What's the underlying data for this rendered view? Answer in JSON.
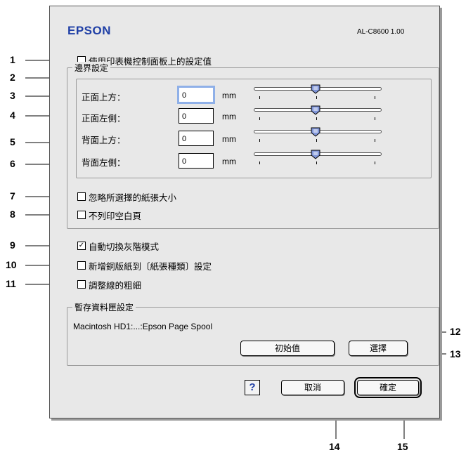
{
  "header": {
    "brand": "EPSON",
    "model": "AL-C8600 1.00"
  },
  "options": {
    "use_panel_settings": {
      "label": "使用印表機控制面板上的設定值",
      "checked": false
    },
    "ignore_paper_size": {
      "label": "忽略所選擇的紙張大小",
      "checked": false
    },
    "skip_blank_page": {
      "label": "不列印空白頁",
      "checked": false
    },
    "auto_grayscale": {
      "label": "自動切換灰階模式",
      "checked": true
    },
    "add_coated_paper": {
      "label": "新增銅版紙到〔紙張種類〕設定",
      "checked": false
    },
    "adjust_line_width": {
      "label": "調整線的粗細",
      "checked": false
    }
  },
  "margin_group": {
    "title": "邊界設定",
    "unit": "mm",
    "rows": [
      {
        "label": "正面上方：",
        "value": "0"
      },
      {
        "label": "正面左側：",
        "value": "0"
      },
      {
        "label": "背面上方：",
        "value": "0"
      },
      {
        "label": "背面左側：",
        "value": "0"
      }
    ]
  },
  "spool_group": {
    "title": "暫存資料匣設定",
    "path": "Macintosh HD1:...:Epson Page Spool",
    "default_button": "初始值",
    "select_button": "選擇"
  },
  "footer": {
    "help": "?",
    "cancel": "取消",
    "ok": "確定"
  },
  "callouts": [
    "1",
    "2",
    "3",
    "4",
    "5",
    "6",
    "7",
    "8",
    "9",
    "10",
    "11",
    "12",
    "13",
    "14",
    "15"
  ],
  "colors": {
    "brand": "#1f3fa6",
    "dialog_bg": "#e8e8e8",
    "focus": "#8fb0e8"
  }
}
